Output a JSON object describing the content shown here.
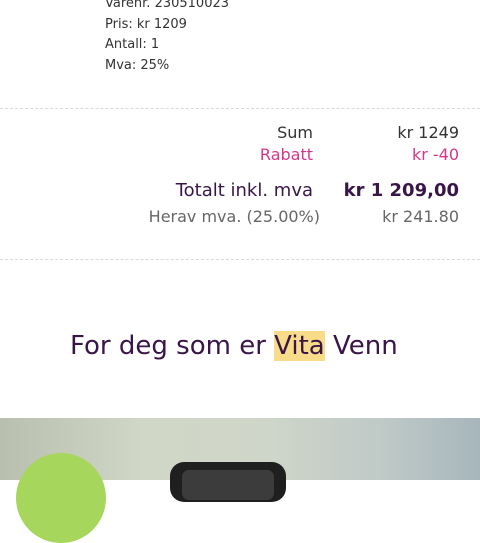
{
  "item": {
    "sku_line": "Varenr. 230510023",
    "price_line": "Pris: kr 1209",
    "quantity_line": "Antall: 1",
    "vat_line": "Mva: 25%"
  },
  "summary": {
    "sum_label": "Sum",
    "sum_value": "kr 1249",
    "discount_label": "Rabatt",
    "discount_value": "kr -40",
    "total_label": "Totalt inkl. mva",
    "total_value": "kr 1 209,00",
    "vat_included_label": "Herav mva. (25.00%)",
    "vat_included_value": "kr 241.80"
  },
  "promo": {
    "prefix": "For deg som er ",
    "highlight": "Vita",
    "suffix": " Venn"
  },
  "colors": {
    "text_dark": "#333333",
    "discount": "#d4378a",
    "total": "#3a1548",
    "muted": "#666666",
    "highlight": "#f9dc8a",
    "badge_green": "#a6d65c"
  }
}
